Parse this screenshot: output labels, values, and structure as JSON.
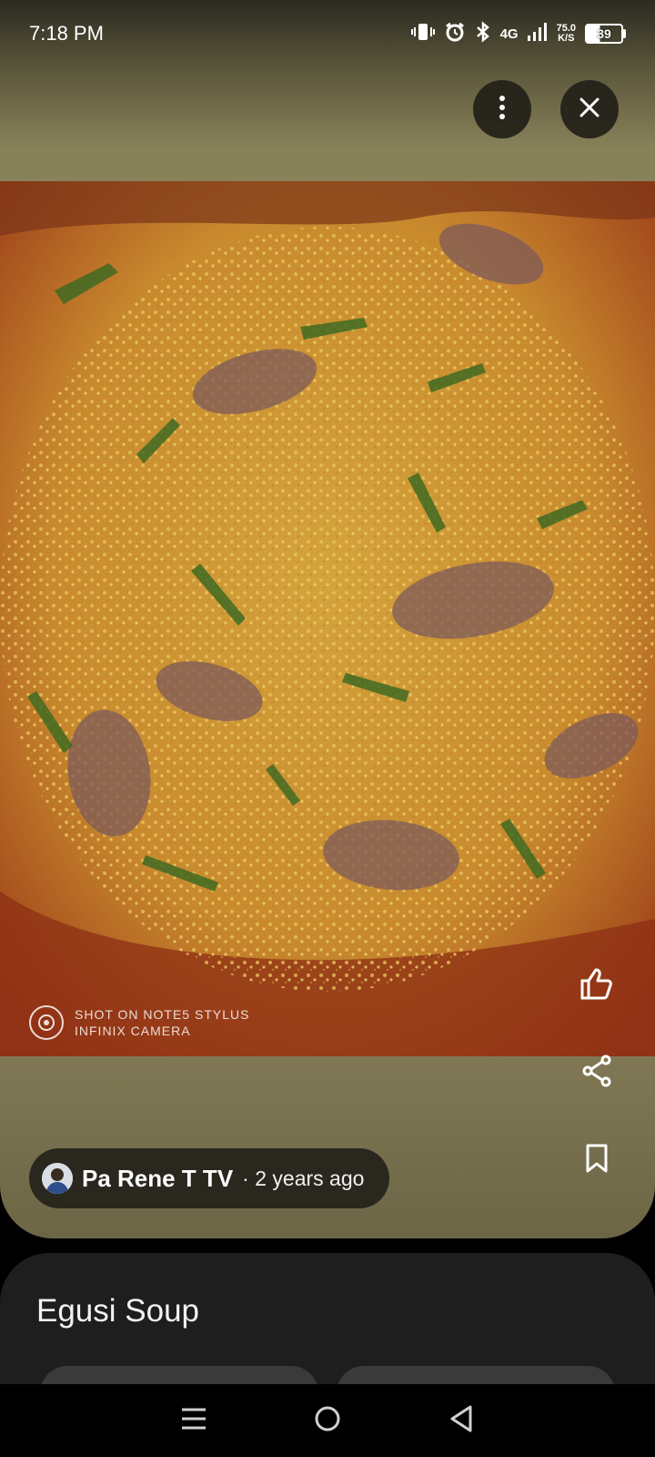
{
  "status_bar": {
    "time": "7:18 PM",
    "network_label": "4G",
    "speed_value": "75.0",
    "speed_unit": "K/S",
    "battery_level": "39",
    "icons": [
      "vibrate-icon",
      "alarm-icon",
      "bluetooth-icon",
      "signal-icon",
      "battery-icon"
    ]
  },
  "viewer": {
    "more_icon": "more-vertical-icon",
    "close_icon": "close-icon",
    "image_watermark_line1": "SHOT ON NOTE5 STYLUS",
    "image_watermark_line2": "INFINIX CAMERA",
    "actions": [
      {
        "name": "like",
        "icon": "thumbs-up-icon"
      },
      {
        "name": "share",
        "icon": "share-icon"
      },
      {
        "name": "save",
        "icon": "bookmark-icon"
      }
    ]
  },
  "source": {
    "name": "Pa Rene T TV",
    "separator": " · ",
    "age": "2 years ago"
  },
  "details": {
    "title": "Egusi Soup"
  },
  "nav": {
    "icons": [
      "menu-icon",
      "home-icon",
      "back-icon"
    ]
  },
  "colors": {
    "viewer_bg": "#88825a",
    "chip_bg": "#26241b",
    "card_bg": "#1e1e1e"
  }
}
